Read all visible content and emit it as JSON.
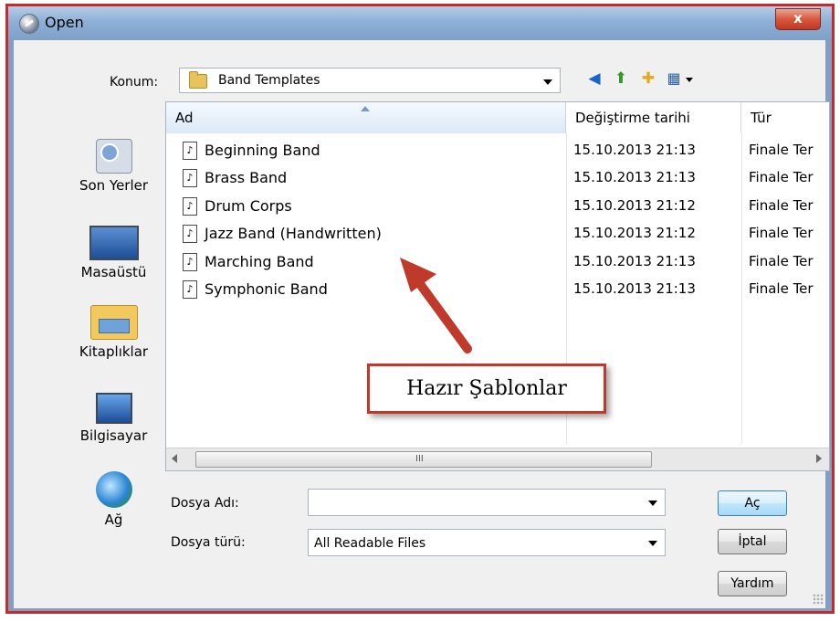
{
  "window": {
    "title": "Open",
    "close_label": "x"
  },
  "location": {
    "label": "Konum:",
    "value": "Band Templates"
  },
  "toolbar": {
    "icons": [
      "back-icon",
      "up-folder-icon",
      "new-folder-icon",
      "view-menu-icon"
    ]
  },
  "places": [
    {
      "label": "Son Yerler",
      "icon": "recent-places-icon"
    },
    {
      "label": "Masaüstü",
      "icon": "desktop-icon"
    },
    {
      "label": "Kitaplıklar",
      "icon": "libraries-icon"
    },
    {
      "label": "Bilgisayar",
      "icon": "computer-icon"
    },
    {
      "label": "Ağ",
      "icon": "network-icon"
    }
  ],
  "columns": {
    "name": "Ad",
    "date": "Değiştirme tarihi",
    "type": "Tür"
  },
  "files": [
    {
      "name": "Beginning Band",
      "date": "15.10.2013 21:13",
      "type": "Finale Ter"
    },
    {
      "name": "Brass Band",
      "date": "15.10.2013 21:13",
      "type": "Finale Ter"
    },
    {
      "name": "Drum Corps",
      "date": "15.10.2013 21:12",
      "type": "Finale Ter"
    },
    {
      "name": "Jazz Band (Handwritten)",
      "date": "15.10.2013 21:12",
      "type": "Finale Ter"
    },
    {
      "name": "Marching Band",
      "date": "15.10.2013 21:13",
      "type": "Finale Ter"
    },
    {
      "name": "Symphonic Band",
      "date": "15.10.2013 21:13",
      "type": "Finale Ter"
    }
  ],
  "annotation": {
    "text": "Hazır Şablonlar",
    "color": "#bf3a2b"
  },
  "scrollbar": {
    "grip": "III"
  },
  "filename": {
    "label": "Dosya Adı:",
    "value": ""
  },
  "filetype": {
    "label": "Dosya türü:",
    "value": "All Readable Files"
  },
  "buttons": {
    "open": "Aç",
    "cancel": "İptal",
    "help": "Yardım"
  }
}
